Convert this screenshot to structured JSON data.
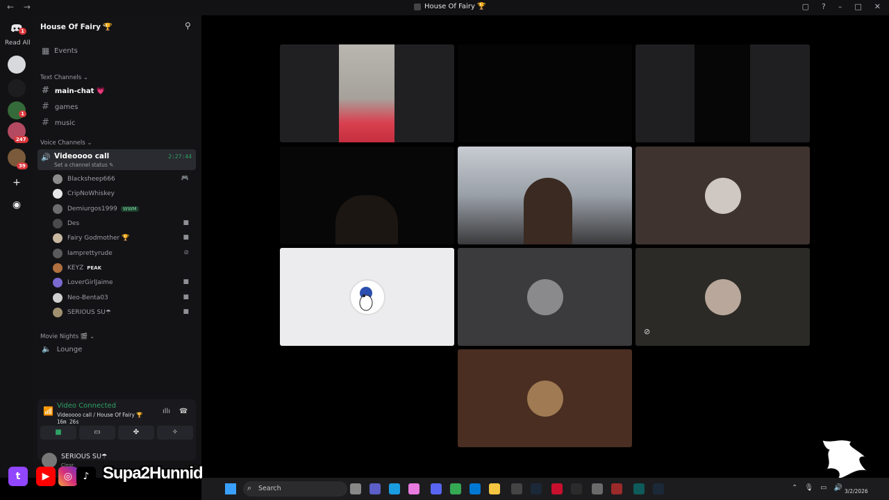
{
  "window": {
    "title": "House Of Fairy 🏆"
  },
  "rail": {
    "read_all": "Read All",
    "badges": [
      "1",
      "1",
      "247",
      "39"
    ]
  },
  "server": {
    "name": "House Of Fairy 🏆"
  },
  "sidebar": {
    "events": "Events",
    "text_category": "Text Channels",
    "text_channels": [
      "main-chat 💗",
      "games",
      "music"
    ],
    "voice_category": "Voice Channels",
    "active_voice": {
      "name": "Videoooo call",
      "status": "Set a channel status ✎",
      "timer": "2:27:44"
    },
    "members": [
      {
        "name": "Blacksheep666",
        "tag": "",
        "icon": "🎮"
      },
      {
        "name": "CripNoWhiskey",
        "tag": "",
        "icon": ""
      },
      {
        "name": "Demiurgos1999",
        "tag": "WWM",
        "icon": ""
      },
      {
        "name": "Des",
        "tag": "",
        "icon": "📹"
      },
      {
        "name": "Fairy Godmother 🏆",
        "tag": "",
        "icon": "📹"
      },
      {
        "name": "Iamprettyrude",
        "tag": "",
        "icon": "🚫"
      },
      {
        "name": "KEYZ",
        "tag": "PEAK",
        "icon": ""
      },
      {
        "name": "LoverGirlJaime",
        "tag": "",
        "icon": "📹"
      },
      {
        "name": "Neo-Benta03",
        "tag": "",
        "icon": "📹"
      },
      {
        "name": "SERIOUS SU☂",
        "tag": "",
        "icon": "📹"
      }
    ],
    "movie_category": "Movie Nights 🎬",
    "lounge": "Lounge"
  },
  "voice_panel": {
    "connected": "Video Connected",
    "sub": "Videoooo call / House Of Fairy 🏆",
    "time": "16m 26s"
  },
  "user": {
    "name": "SERIOUS SU☂",
    "status": "Clear"
  },
  "branding": {
    "handle": "Supa2Hunnid"
  },
  "taskbar": {
    "search": "Search",
    "date": "3/2/2026"
  },
  "colors": {
    "accent_green": "#2ea266",
    "badge_red": "#da373c",
    "twitch": "#9146ff",
    "youtube": "#ff0000"
  }
}
